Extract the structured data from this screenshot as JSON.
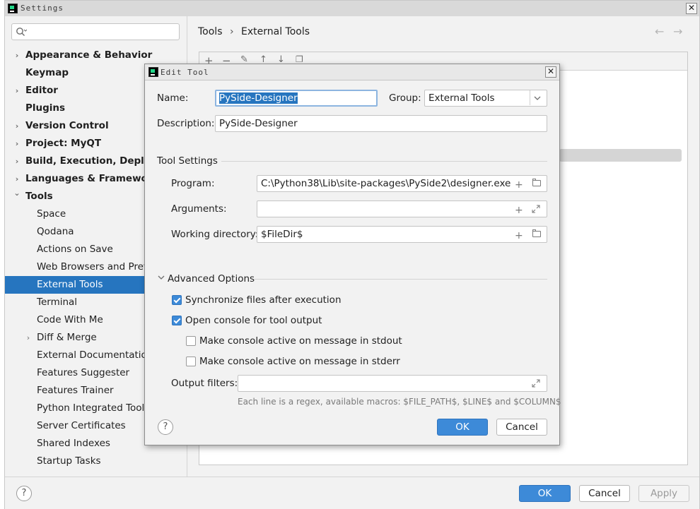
{
  "settings_window": {
    "title": "Settings",
    "search": {
      "placeholder": "",
      "value": ""
    },
    "tree": [
      {
        "label": "Appearance & Behavior",
        "level": 0,
        "bold": true,
        "expandable": true
      },
      {
        "label": "Keymap",
        "level": 0,
        "bold": true,
        "expandable": false
      },
      {
        "label": "Editor",
        "level": 0,
        "bold": true,
        "expandable": true
      },
      {
        "label": "Plugins",
        "level": 0,
        "bold": true,
        "expandable": false
      },
      {
        "label": "Version Control",
        "level": 0,
        "bold": true,
        "expandable": true
      },
      {
        "label": "Project: MyQT",
        "level": 0,
        "bold": true,
        "expandable": true
      },
      {
        "label": "Build, Execution, Deployment",
        "level": 0,
        "bold": true,
        "expandable": true
      },
      {
        "label": "Languages & Frameworks",
        "level": 0,
        "bold": true,
        "expandable": true
      },
      {
        "label": "Tools",
        "level": 0,
        "bold": true,
        "expandable": true,
        "expanded": true
      },
      {
        "label": "Space",
        "level": 1
      },
      {
        "label": "Qodana",
        "level": 1
      },
      {
        "label": "Actions on Save",
        "level": 1
      },
      {
        "label": "Web Browsers and Preview",
        "level": 1
      },
      {
        "label": "External Tools",
        "level": 1,
        "selected": true
      },
      {
        "label": "Terminal",
        "level": 1
      },
      {
        "label": "Code With Me",
        "level": 1
      },
      {
        "label": "Diff & Merge",
        "level": 1,
        "expandable": true
      },
      {
        "label": "External Documentation",
        "level": 1
      },
      {
        "label": "Features Suggester",
        "level": 1
      },
      {
        "label": "Features Trainer",
        "level": 1
      },
      {
        "label": "Python Integrated Tools",
        "level": 1
      },
      {
        "label": "Server Certificates",
        "level": 1
      },
      {
        "label": "Shared Indexes",
        "level": 1
      },
      {
        "label": "Startup Tasks",
        "level": 1
      }
    ],
    "breadcrumb": {
      "parent": "Tools",
      "separator": "›",
      "current": "External Tools"
    },
    "nav": {
      "back": "←",
      "forward": "→"
    },
    "toolbar_icons": [
      "add-icon",
      "remove-icon",
      "edit-icon",
      "move-up-icon",
      "move-down-icon",
      "copy-icon"
    ],
    "buttons": {
      "help": "?",
      "ok": "OK",
      "cancel": "Cancel",
      "apply": "Apply"
    }
  },
  "edit_tool_dialog": {
    "title": "Edit Tool",
    "name_label": "Name:",
    "name_value": "PySide-Designer",
    "group_label": "Group:",
    "group_value": "External Tools",
    "description_label": "Description:",
    "description_value": "PySide-Designer",
    "tool_settings_header": "Tool Settings",
    "program_label": "Program:",
    "program_value": "C:\\Python38\\Lib\\site-packages\\PySide2\\designer.exe",
    "arguments_label": "Arguments:",
    "arguments_value": "",
    "working_dir_label": "Working directory:",
    "working_dir_value": "$FileDir$",
    "advanced_header": "Advanced Options",
    "options": [
      {
        "label": "Synchronize files after execution",
        "checked": true
      },
      {
        "label": "Open console for tool output",
        "checked": true
      },
      {
        "label": "Make console active on message in stdout",
        "checked": false
      },
      {
        "label": "Make console active on message in stderr",
        "checked": false
      }
    ],
    "output_filters_label": "Output filters:",
    "output_filters_value": "",
    "output_filters_hint": "Each line is a regex, available macros: $FILE_PATH$, $LINE$ and $COLUMN$",
    "buttons": {
      "help": "?",
      "ok": "OK",
      "cancel": "Cancel"
    }
  },
  "colors": {
    "accent": "#2675bf",
    "primary_button": "#3d8ad8",
    "background": "#f2f2f2"
  }
}
